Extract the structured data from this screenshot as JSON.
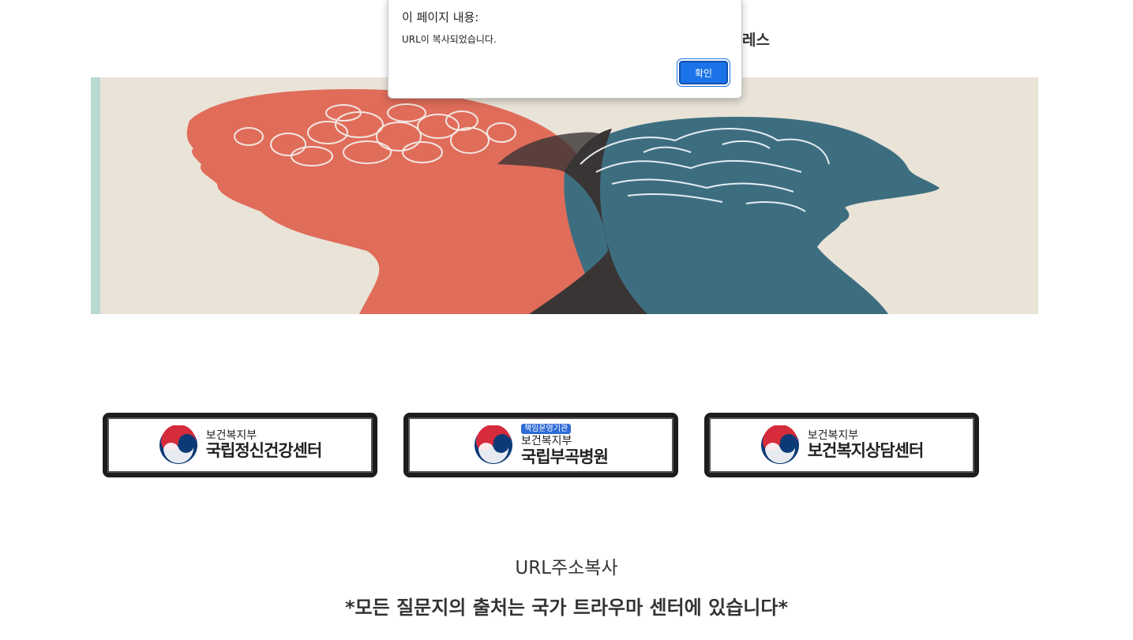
{
  "page": {
    "title_partial": "레스",
    "url_copy_label": "URL주소복사",
    "footer_note": "*모든 질문지의 출처는 국가 트라우마 센터에 있습니다*"
  },
  "logos": [
    {
      "ministry": "보건복지부",
      "name": "국립정신건강센터",
      "badge": ""
    },
    {
      "ministry": "보건복지부",
      "name": "국립부곡병원",
      "badge": "책임운영기관"
    },
    {
      "ministry": "보건복지부",
      "name": "보건복지상담센터",
      "badge": ""
    }
  ],
  "dialog": {
    "title": "이 페이지 내용:",
    "message": "URL이 복사되었습니다.",
    "ok_label": "확인"
  },
  "colors": {
    "hero_background": "#e9e3d8",
    "left_head": "#e06c5a",
    "right_head": "#3d6e80",
    "overlap": "#3a3535",
    "dialog_button": "#1a73e8",
    "emblem_red": "#d62b3b",
    "emblem_blue": "#0c3a76"
  }
}
